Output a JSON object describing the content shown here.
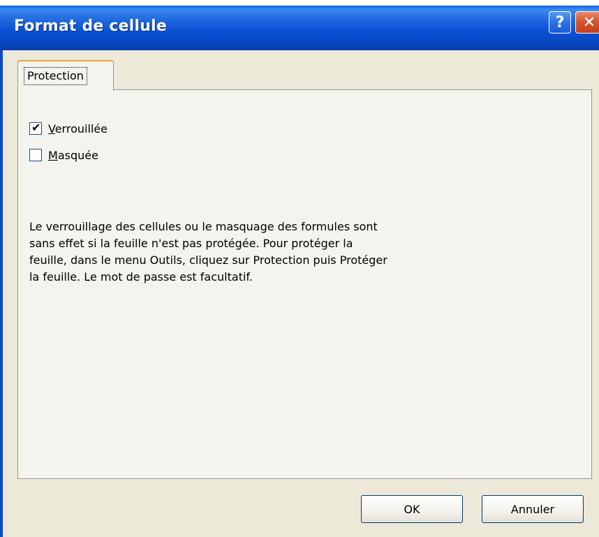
{
  "window": {
    "title": "Format de cellule",
    "help_label": "?",
    "close_label": "✕"
  },
  "tabs": [
    {
      "label": "Protection",
      "active": true
    }
  ],
  "checkboxes": [
    {
      "label_accel": "V",
      "label_rest": "errouillée",
      "checked": true
    },
    {
      "label_accel": "M",
      "label_rest": "asquée",
      "checked": false
    }
  ],
  "info": {
    "line1": "Le verrouillage des cellules ou le masquage des formules sont",
    "line2": "sans effet si la feuille n'est pas protégée. Pour protéger la",
    "line3": "feuille, dans le menu Outils, cliquez sur Protection puis Protéger",
    "line4": "la feuille. Le mot de passe est facultatif."
  },
  "buttons": {
    "ok": "OK",
    "cancel": "Annuler"
  },
  "colors": {
    "titlebar": "#0a52d3",
    "dialog_bg": "#ece9d8",
    "panel_bg": "#f4f3ee",
    "tab_highlight": "#e8a33a",
    "checkmark": "#21a121"
  }
}
